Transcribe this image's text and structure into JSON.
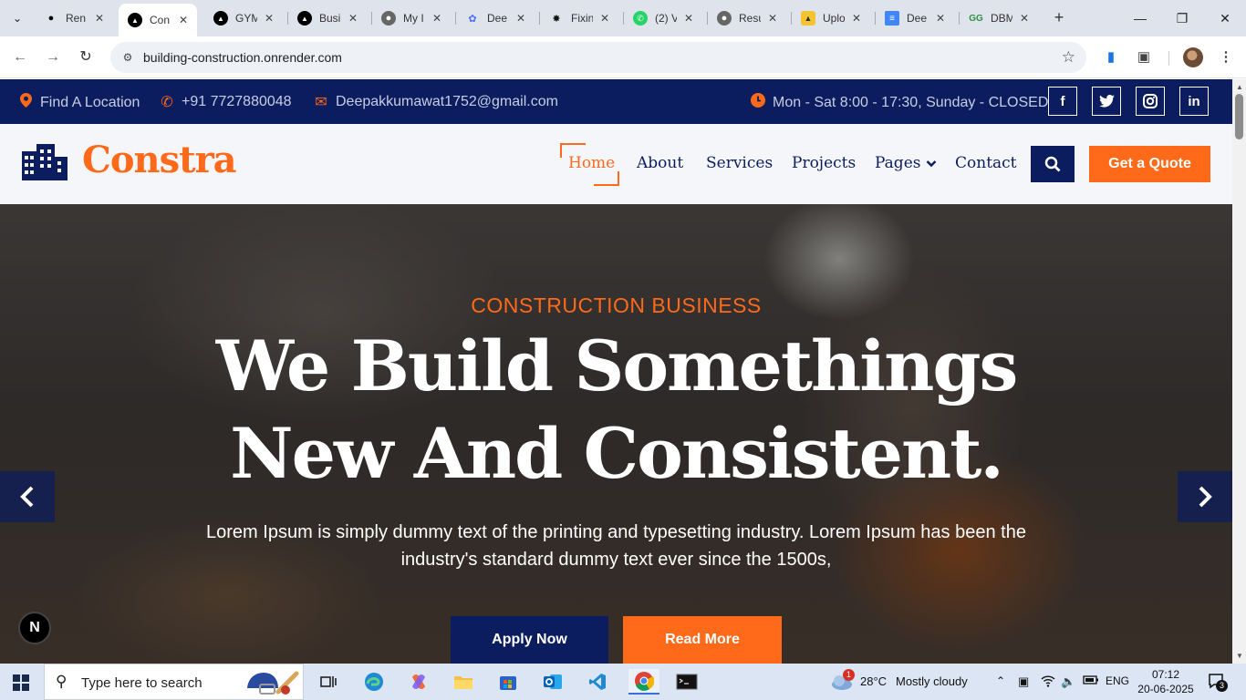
{
  "browser": {
    "tabs": [
      {
        "title": "Ren",
        "favicon": "render-icon",
        "active": false
      },
      {
        "title": "Con",
        "favicon": "triangle-icon",
        "active": true
      },
      {
        "title": "GYM",
        "favicon": "triangle-icon",
        "active": false
      },
      {
        "title": "Busi",
        "favicon": "triangle-icon",
        "active": false
      },
      {
        "title": "My I",
        "favicon": "globe-icon",
        "active": false
      },
      {
        "title": "Dee",
        "favicon": "copilot-icon",
        "active": false
      },
      {
        "title": "Fixin",
        "favicon": "openai-icon",
        "active": false
      },
      {
        "title": "(2) V",
        "favicon": "whatsapp-icon",
        "active": false
      },
      {
        "title": "Resu",
        "favicon": "globe-icon",
        "active": false
      },
      {
        "title": "Uplo",
        "favicon": "hat-icon",
        "active": false
      },
      {
        "title": "Dee",
        "favicon": "docs-icon",
        "active": false
      },
      {
        "title": "DBM",
        "favicon": "gfg-icon",
        "active": false
      }
    ],
    "url": "building-construction.onrender.com"
  },
  "topbar": {
    "location": "Find A Location",
    "phone": "+91 7727880048",
    "email": "Deepakkumawat1752@gmail.com",
    "hours": "Mon - Sat 8:00 - 17:30, Sunday - CLOSED",
    "social": [
      "f",
      "t",
      "ig",
      "in"
    ]
  },
  "header": {
    "logo": "Constra",
    "nav": {
      "home": "Home",
      "about": "About",
      "services": "Services",
      "projects": "Projects",
      "pages": "Pages",
      "contact": "Contact"
    },
    "quote_button": "Get a Quote"
  },
  "hero": {
    "eyebrow": "CONSTRUCTION BUSINESS",
    "headline_line1": "We Build Somethings",
    "headline_line2": "New And Consistent.",
    "description": "Lorem Ipsum is simply dummy text of the printing and typesetting industry. Lorem Ipsum has been the industry's standard dummy text ever since the 1500s,",
    "apply_button": "Apply Now",
    "read_more_button": "Read More",
    "badge": "N"
  },
  "taskbar": {
    "search_placeholder": "Type here to search",
    "weather_temp": "28°C",
    "weather_text": "Mostly cloudy",
    "weather_alert": "1",
    "language": "ENG",
    "time": "07:12",
    "date": "20-06-2025",
    "notifications": "3"
  },
  "colors": {
    "brand_navy": "#0b1d5e",
    "brand_orange": "#ff6a1a"
  }
}
